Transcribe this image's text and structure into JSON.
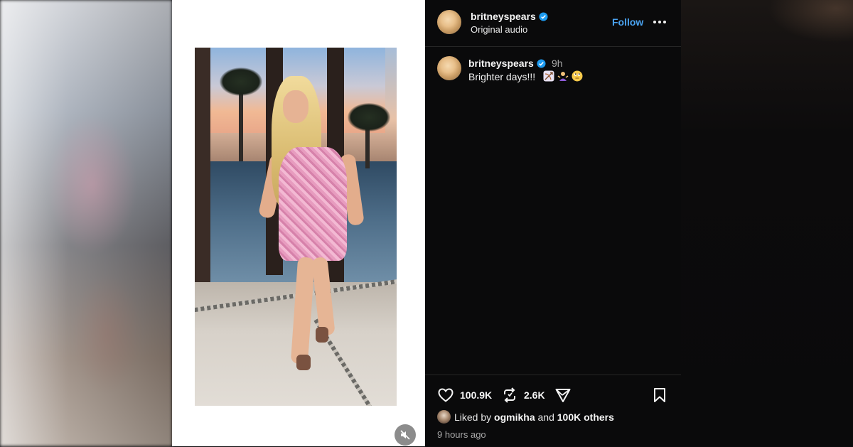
{
  "header": {
    "username": "britneyspears",
    "subtitle": "Original audio",
    "follow_label": "Follow"
  },
  "caption": {
    "username": "britneyspears",
    "time": "9h",
    "text": "Brighter days!!!",
    "emojis": [
      "bow-and-arrow-emoji",
      "person-shrugging-emoji",
      "face-with-rolling-eyes-emoji"
    ]
  },
  "actions": {
    "likes": "100.9K",
    "reposts": "2.6K"
  },
  "liked_by": {
    "prefix": "Liked by",
    "user": "ogmikha",
    "conjunction": "and",
    "others": "100K others"
  },
  "timestamp": "9 hours ago",
  "colors": {
    "panel_bg": "#0a0a0b",
    "follow_accent": "#4aa3f0",
    "verified_badge": "#1d9bf0",
    "divider": "#262626"
  },
  "video": {
    "muted": true
  }
}
